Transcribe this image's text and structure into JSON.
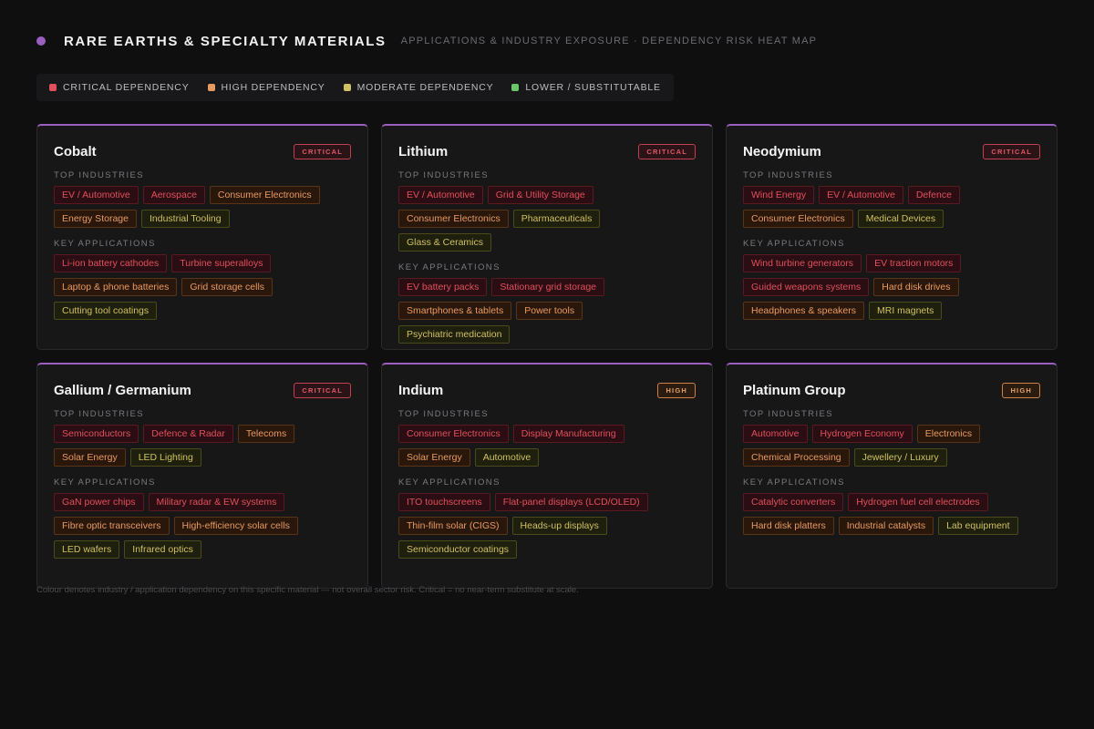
{
  "header": {
    "title": "RARE EARTHS & SPECIALTY MATERIALS",
    "subtitle": "APPLICATIONS & INDUSTRY EXPOSURE · DEPENDENCY RISK HEAT MAP"
  },
  "colors": {
    "critical": "#e24f5c",
    "high": "#e89a60",
    "moderate": "#d0c060",
    "low": "#6cc46c",
    "accent": "#9b5fc0"
  },
  "legend": [
    {
      "label": "CRITICAL DEPENDENCY",
      "level": "critical"
    },
    {
      "label": "HIGH DEPENDENCY",
      "level": "high"
    },
    {
      "label": "MODERATE DEPENDENCY",
      "level": "moderate"
    },
    {
      "label": "LOWER / SUBSTITUTABLE",
      "level": "low"
    }
  ],
  "labels": {
    "industries": "TOP INDUSTRIES",
    "applications": "KEY APPLICATIONS"
  },
  "cards": [
    {
      "title": "Cobalt",
      "badge": "CRITICAL",
      "badge_level": "critical",
      "industries": [
        {
          "label": "EV / Automotive",
          "level": "critical"
        },
        {
          "label": "Aerospace",
          "level": "critical"
        },
        {
          "label": "Consumer Electronics",
          "level": "high"
        },
        {
          "label": "Energy Storage",
          "level": "high"
        },
        {
          "label": "Industrial Tooling",
          "level": "moderate"
        }
      ],
      "applications": [
        {
          "label": "Li-ion battery cathodes",
          "level": "critical"
        },
        {
          "label": "Turbine superalloys",
          "level": "critical"
        },
        {
          "label": "Laptop & phone batteries",
          "level": "high"
        },
        {
          "label": "Grid storage cells",
          "level": "high"
        },
        {
          "label": "Cutting tool coatings",
          "level": "moderate"
        }
      ]
    },
    {
      "title": "Lithium",
      "badge": "CRITICAL",
      "badge_level": "critical",
      "industries": [
        {
          "label": "EV / Automotive",
          "level": "critical"
        },
        {
          "label": "Grid & Utility Storage",
          "level": "critical"
        },
        {
          "label": "Consumer Electronics",
          "level": "high"
        },
        {
          "label": "Pharmaceuticals",
          "level": "moderate"
        },
        {
          "label": "Glass & Ceramics",
          "level": "moderate"
        }
      ],
      "applications": [
        {
          "label": "EV battery packs",
          "level": "critical"
        },
        {
          "label": "Stationary grid storage",
          "level": "critical"
        },
        {
          "label": "Smartphones & tablets",
          "level": "high"
        },
        {
          "label": "Power tools",
          "level": "high"
        },
        {
          "label": "Psychiatric medication",
          "level": "moderate"
        }
      ]
    },
    {
      "title": "Neodymium",
      "badge": "CRITICAL",
      "badge_level": "critical",
      "industries": [
        {
          "label": "Wind Energy",
          "level": "critical"
        },
        {
          "label": "EV / Automotive",
          "level": "critical"
        },
        {
          "label": "Defence",
          "level": "critical"
        },
        {
          "label": "Consumer Electronics",
          "level": "high"
        },
        {
          "label": "Medical Devices",
          "level": "moderate"
        }
      ],
      "applications": [
        {
          "label": "Wind turbine generators",
          "level": "critical"
        },
        {
          "label": "EV traction motors",
          "level": "critical"
        },
        {
          "label": "Guided weapons systems",
          "level": "critical"
        },
        {
          "label": "Hard disk drives",
          "level": "high"
        },
        {
          "label": "Headphones & speakers",
          "level": "high"
        },
        {
          "label": "MRI magnets",
          "level": "moderate"
        }
      ]
    },
    {
      "title": "Gallium / Germanium",
      "badge": "CRITICAL",
      "badge_level": "critical",
      "industries": [
        {
          "label": "Semiconductors",
          "level": "critical"
        },
        {
          "label": "Defence & Radar",
          "level": "critical"
        },
        {
          "label": "Telecoms",
          "level": "high"
        },
        {
          "label": "Solar Energy",
          "level": "high"
        },
        {
          "label": "LED Lighting",
          "level": "moderate"
        }
      ],
      "applications": [
        {
          "label": "GaN power chips",
          "level": "critical"
        },
        {
          "label": "Military radar & EW systems",
          "level": "critical"
        },
        {
          "label": "Fibre optic transceivers",
          "level": "high"
        },
        {
          "label": "High-efficiency solar cells",
          "level": "high"
        },
        {
          "label": "LED wafers",
          "level": "moderate"
        },
        {
          "label": "Infrared optics",
          "level": "moderate"
        }
      ]
    },
    {
      "title": "Indium",
      "badge": "HIGH",
      "badge_level": "high",
      "industries": [
        {
          "label": "Consumer Electronics",
          "level": "critical"
        },
        {
          "label": "Display Manufacturing",
          "level": "critical"
        },
        {
          "label": "Solar Energy",
          "level": "high"
        },
        {
          "label": "Automotive",
          "level": "moderate"
        }
      ],
      "applications": [
        {
          "label": "ITO touchscreens",
          "level": "critical"
        },
        {
          "label": "Flat-panel displays (LCD/OLED)",
          "level": "critical"
        },
        {
          "label": "Thin-film solar (CIGS)",
          "level": "high"
        },
        {
          "label": "Heads-up displays",
          "level": "moderate"
        },
        {
          "label": "Semiconductor coatings",
          "level": "moderate"
        }
      ]
    },
    {
      "title": "Platinum Group",
      "badge": "HIGH",
      "badge_level": "high",
      "industries": [
        {
          "label": "Automotive",
          "level": "critical"
        },
        {
          "label": "Hydrogen Economy",
          "level": "critical"
        },
        {
          "label": "Electronics",
          "level": "high"
        },
        {
          "label": "Chemical Processing",
          "level": "high"
        },
        {
          "label": "Jewellery / Luxury",
          "level": "moderate"
        }
      ],
      "applications": [
        {
          "label": "Catalytic converters",
          "level": "critical"
        },
        {
          "label": "Hydrogen fuel cell electrodes",
          "level": "critical"
        },
        {
          "label": "Hard disk platters",
          "level": "high"
        },
        {
          "label": "Industrial catalysts",
          "level": "high"
        },
        {
          "label": "Lab equipment",
          "level": "moderate"
        }
      ]
    }
  ],
  "footnote": "Colour denotes industry / application dependency on this specific material — not overall sector risk. Critical = no near-term substitute at scale."
}
